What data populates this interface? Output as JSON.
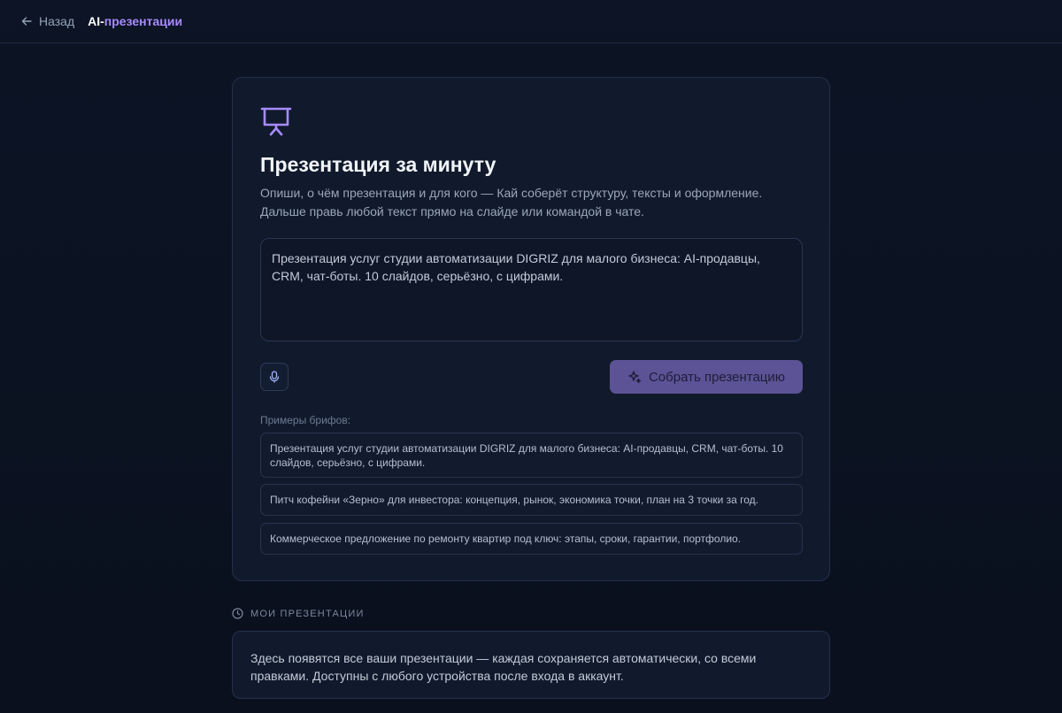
{
  "header": {
    "back_label": "Назад",
    "brand_prefix": "AI-",
    "brand_suffix": "презентации",
    "back_icon": "arrow-left-icon"
  },
  "card": {
    "icon": "presentation-icon",
    "title": "Презентация за минуту",
    "description": "Опиши, о чём презентация и для кого — Кай соберёт структуру, тексты и оформление. Дальше правь любой текст прямо на слайде или командой в чате.",
    "brief_value": "Презентация услуг студии автоматизации DIGRIZ для малого бизнеса: AI-продавцы, CRM, чат-боты. 10 слайдов, серьёзно, с цифрами.",
    "mic_icon": "microphone-icon",
    "build_button_label": "Собрать презентацию",
    "build_button_icon": "sparkle-icon",
    "examples_label": "Примеры брифов:",
    "examples": [
      "Презентация услуг студии автоматизации DIGRIZ для малого бизнеса: AI-продавцы, CRM, чат-боты. 10 слайдов, серьёзно, с цифрами.",
      "Питч кофейни «Зерно» для инвестора: концепция, рынок, экономика точки, план на 3 точки за год.",
      "Коммерческое предложение по ремонту квартир под ключ: этапы, сроки, гарантии, портфолио."
    ]
  },
  "my_presentations": {
    "heading": "МОИ ПРЕЗЕНТАЦИИ",
    "icon": "clock-icon",
    "empty_text": "Здесь появятся все ваши презентации — каждая сохраняется автоматически, со всеми правками. Доступны с любого устройства после входа в аккаунт."
  },
  "colors": {
    "background": "#0b1120",
    "card": "#111a2c",
    "accent": "#a78bfa",
    "button": "#5b5396"
  }
}
